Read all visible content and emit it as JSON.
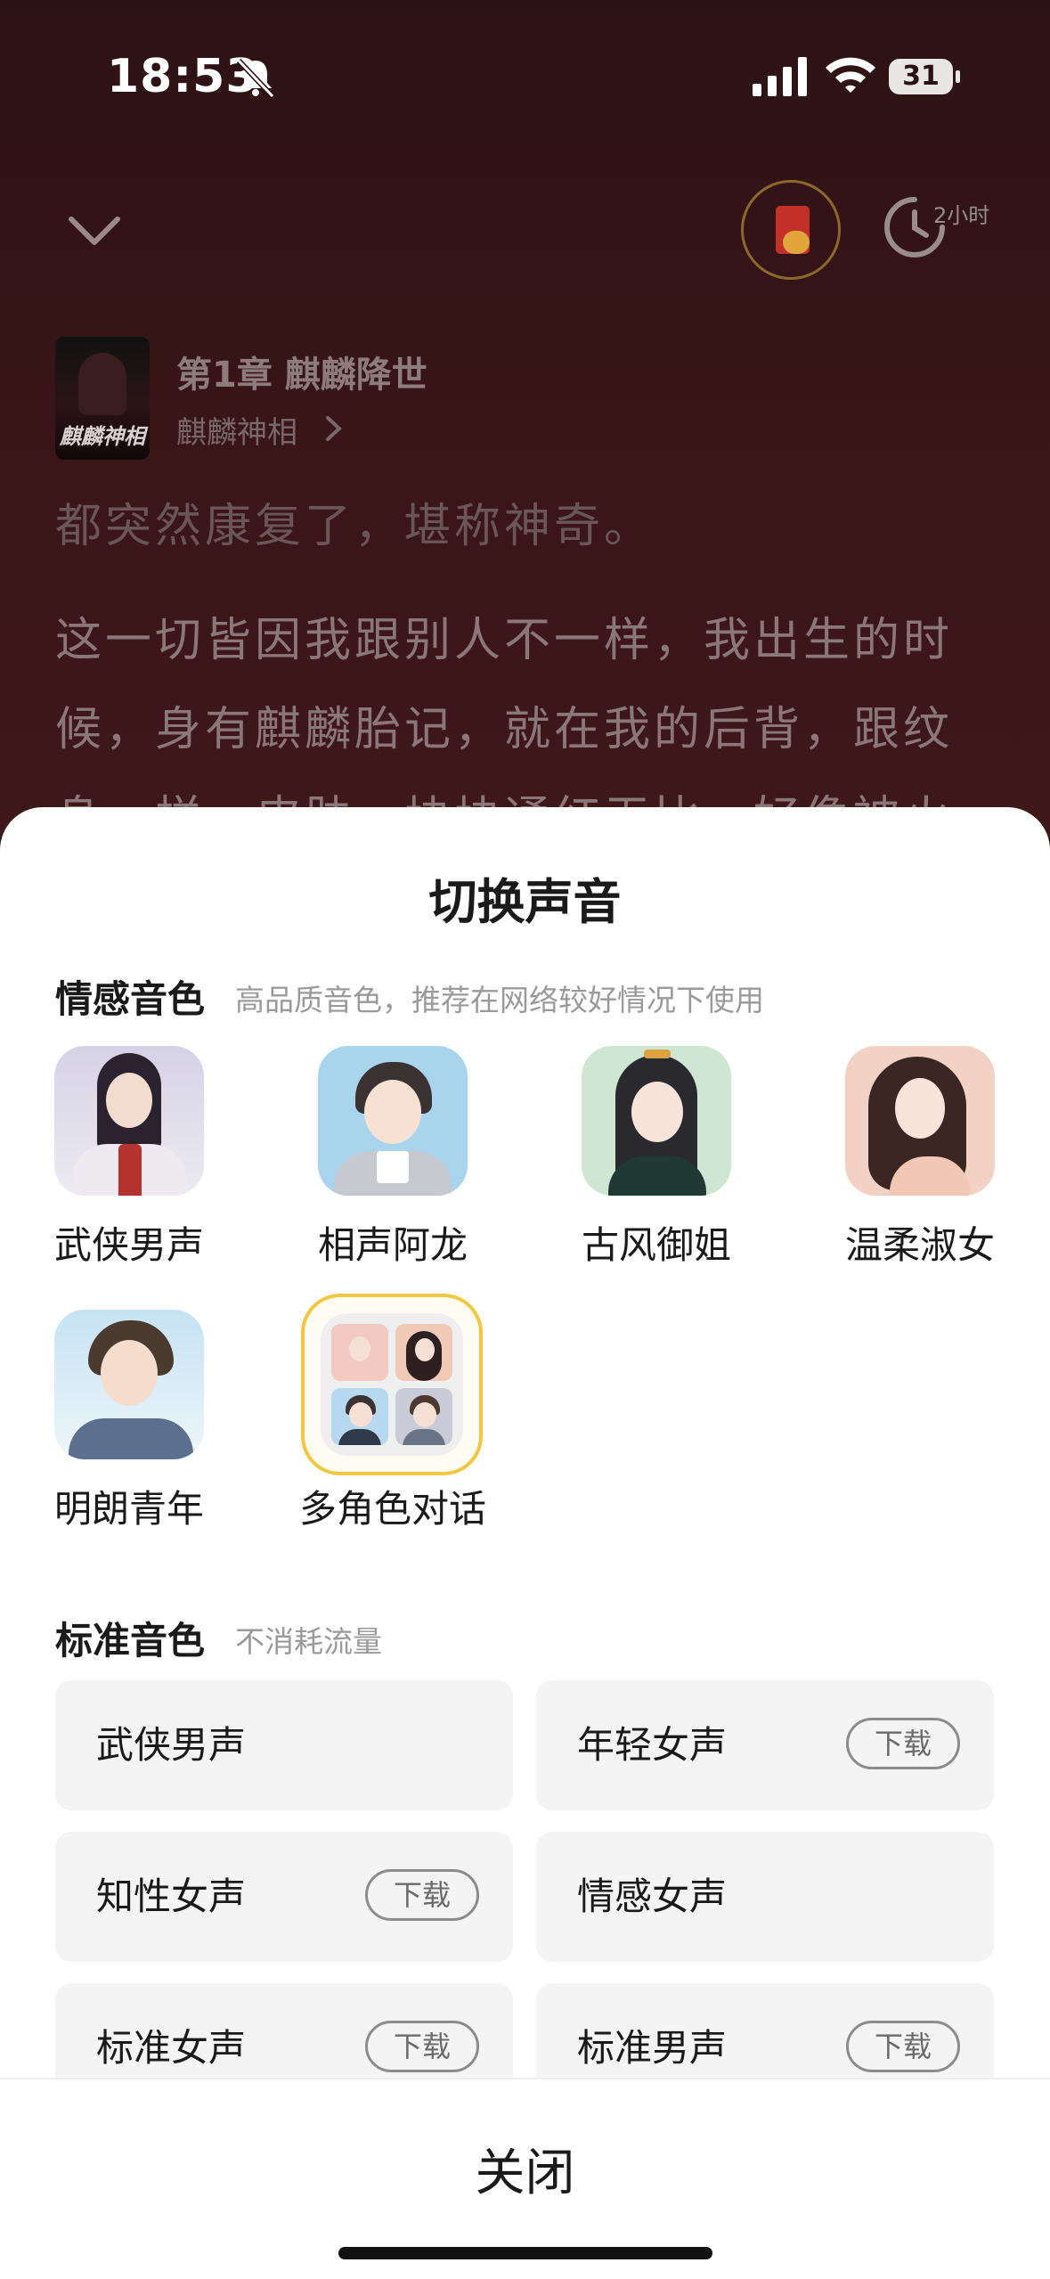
{
  "status_bar": {
    "time": "18:53",
    "battery": "31"
  },
  "player": {
    "timer_label": "2小时",
    "cover_text": "麒麟神相",
    "chapter_title": "第1章 麒麟降世",
    "book_title": "麒麟神相",
    "text_lines": [
      "都突然康复了，堪称神奇。",
      "这一切皆因我跟别人不一样，我出生的时",
      "候，身有麒麟胎记，就在我的后背，跟纹",
      "身一样，皮肤一块块通红无比，好像被火"
    ]
  },
  "sheet": {
    "title": "切换声音",
    "emotional": {
      "title": "情感音色",
      "subtitle": "高品质音色，推荐在网络较好情况下使用",
      "voices": [
        {
          "label": "武侠男声"
        },
        {
          "label": "相声阿龙"
        },
        {
          "label": "古风御姐"
        },
        {
          "label": "温柔淑女"
        },
        {
          "label": "明朗青年"
        },
        {
          "label": "多角色对话"
        }
      ]
    },
    "standard": {
      "title": "标准音色",
      "subtitle": "不消耗流量",
      "download_label": "下载",
      "voices": [
        {
          "label": "武侠男声",
          "download": false
        },
        {
          "label": "年轻女声",
          "download": true
        },
        {
          "label": "知性女声",
          "download": true
        },
        {
          "label": "情感女声",
          "download": false
        },
        {
          "label": "标准女声",
          "download": true
        },
        {
          "label": "标准男声",
          "download": true
        }
      ]
    },
    "close_label": "关闭"
  },
  "colors": {
    "selected_ring": "#f2c744",
    "player_bg": "#3a1618",
    "sheet_bg": "#ffffff"
  }
}
